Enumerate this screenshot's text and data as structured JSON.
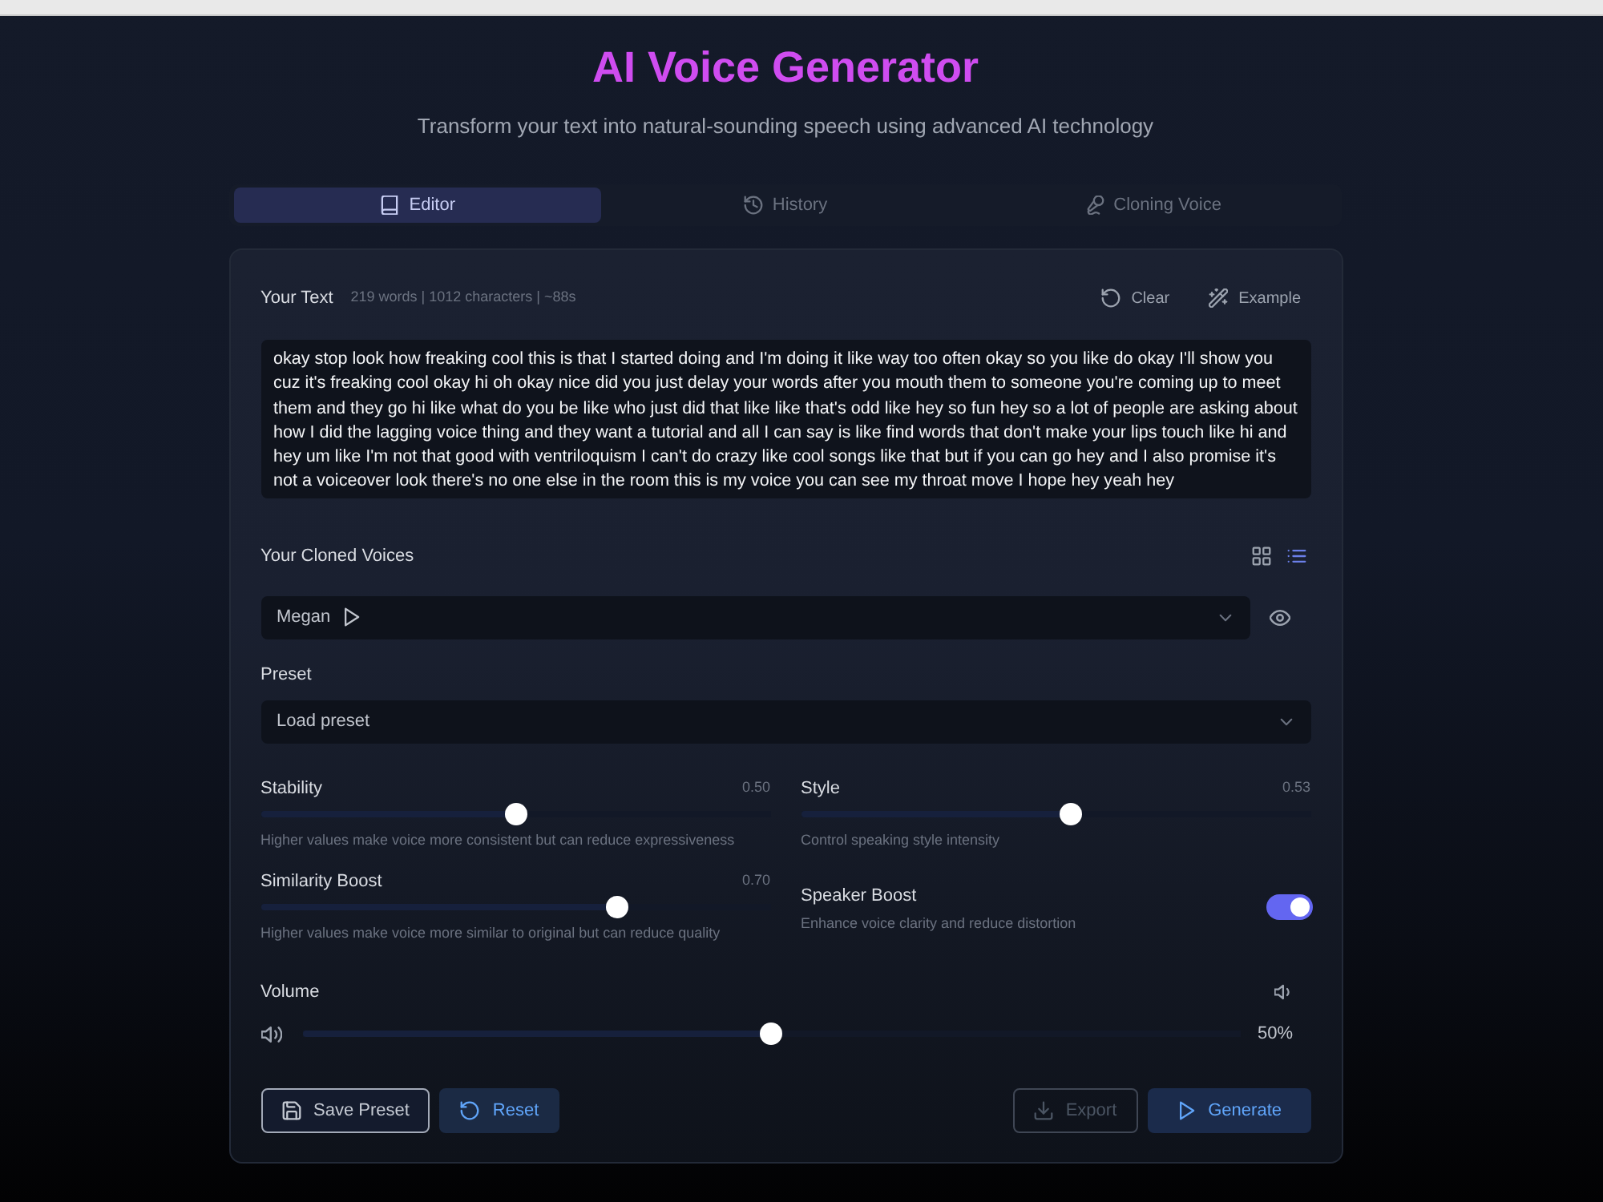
{
  "header": {
    "title": "AI Voice Generator",
    "subtitle": "Transform your text into natural-sounding speech using advanced AI technology"
  },
  "tabs": [
    {
      "label": "Editor",
      "selected": true
    },
    {
      "label": "History",
      "selected": false
    },
    {
      "label": "Cloning Voice",
      "selected": false
    }
  ],
  "text_editor": {
    "label": "Your Text",
    "stats": "219 words | 1012 characters | ~88s",
    "actions": [
      {
        "label": "Clear"
      },
      {
        "label": "Example"
      }
    ],
    "value": "okay stop look how freaking cool this is that I started doing and I'm doing it like way too often okay so you like do okay I'll show you cuz it's freaking cool okay hi oh okay nice did you just delay your words after you mouth them to someone you're coming up to meet them and they go hi like what do you be like who just did that like like that's odd like hey so fun hey so a lot of people are asking about how I did the lagging voice thing and they want a tutorial and all I can say is like find words that don't make your lips touch like hi and hey um like I'm not that good with ventriloquism I can't do crazy like cool songs like that but if you can go hey and I also promise it's not a voiceover look there's no one else in the room this is my voice you can see my throat move I hope hey yeah hey"
  },
  "cloned_voices": {
    "label": "Your Cloned Voices",
    "views": [
      {
        "kind": "grid",
        "selected": false
      },
      {
        "kind": "list",
        "selected": true
      }
    ],
    "select": {
      "value": "Megan"
    }
  },
  "preset": {
    "label": "Preset",
    "select": {
      "value": "Load preset"
    }
  },
  "settings": [
    {
      "kind": "slider",
      "label": "Stability",
      "reading": "0.50",
      "level": 0.5,
      "hint": "Higher values make voice more consistent but can reduce expressiveness"
    },
    {
      "kind": "slider",
      "label": "Style",
      "reading": "0.53",
      "level": 0.53,
      "hint": "Control speaking style intensity"
    },
    {
      "kind": "slider",
      "label": "Similarity Boost",
      "reading": "0.70",
      "level": 0.7,
      "hint": "Higher values make voice more similar to original but can reduce quality"
    },
    {
      "kind": "toggle",
      "label": "Speaker Boost",
      "hint": "Enhance voice clarity and reduce distortion",
      "on": true
    }
  ],
  "volume": {
    "label": "Volume",
    "level": 0.5,
    "reading": "50%"
  },
  "actions": {
    "left": [
      {
        "label": "Save Preset",
        "kind": "outline",
        "disabled": false
      },
      {
        "label": "Reset",
        "kind": "soft",
        "disabled": false
      }
    ],
    "right": [
      {
        "label": "Export",
        "kind": "outline",
        "disabled": true
      },
      {
        "label": "Generate",
        "kind": "primary",
        "disabled": false
      }
    ]
  }
}
